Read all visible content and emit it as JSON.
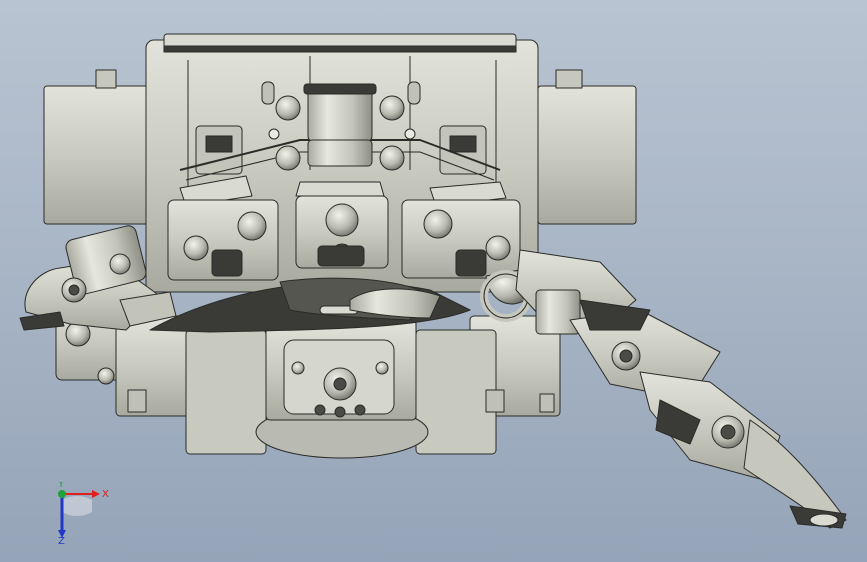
{
  "viewport": {
    "background_top": "#b9c4d2",
    "background_bottom": "#95a4b8",
    "model_fill": "#cfd0c6",
    "model_shadow": "#9c9d94",
    "model_edge": "#2b2b28",
    "model_dark": "#3a3b37"
  },
  "triad": {
    "x_label": "X",
    "y_label": "Y",
    "z_label": "Z",
    "x_color": "#e0201e",
    "y_color": "#1fa23a",
    "z_color": "#2436c8"
  }
}
